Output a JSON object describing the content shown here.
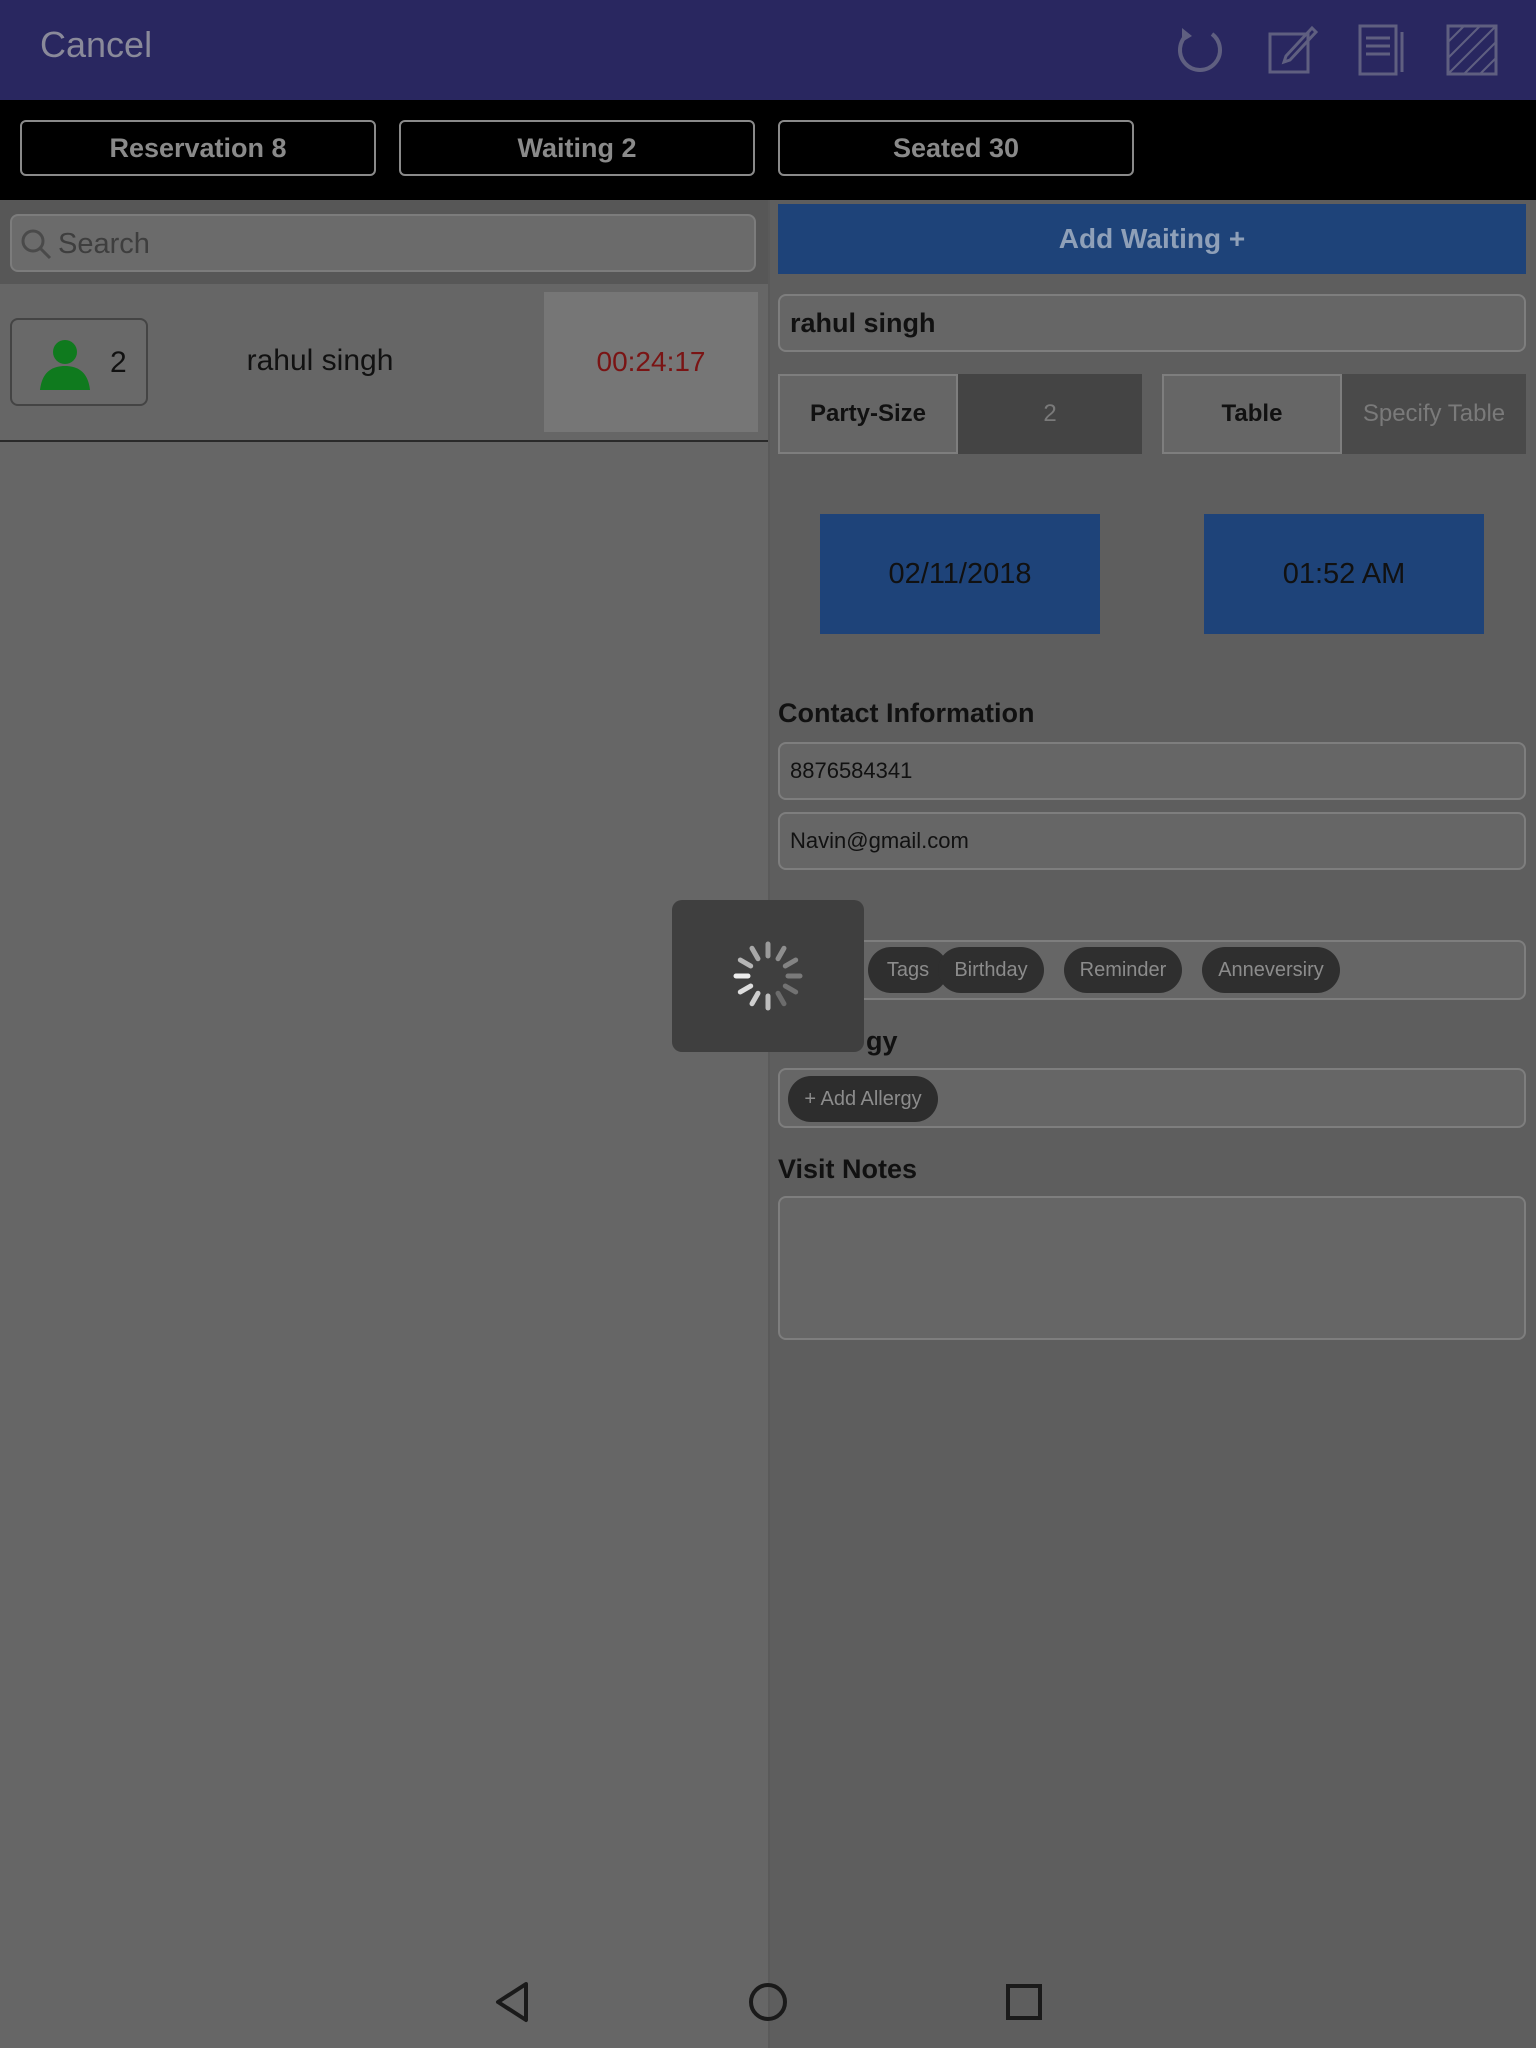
{
  "topbar": {
    "cancel_label": "Cancel",
    "icons": [
      "refresh-icon",
      "edit-icon",
      "notes-icon",
      "hatch-layout-icon"
    ]
  },
  "tabs": [
    {
      "label": "Reservation 8"
    },
    {
      "label": "Waiting 2"
    },
    {
      "label": "Seated 30"
    }
  ],
  "search": {
    "placeholder": "Search"
  },
  "list": [
    {
      "party_size": "2",
      "name": "rahul singh",
      "timer": "00:24:17"
    }
  ],
  "form": {
    "add_waiting_label": "Add Waiting +",
    "guest_name": "rahul singh",
    "party_size_label": "Party-Size",
    "party_size_value": "2",
    "table_label": "Table",
    "table_placeholder": "Specify Table",
    "date": "02/11/2018",
    "time": "01:52 AM",
    "contact_heading": "Contact Information",
    "phone": "8876584341",
    "email": "Navin@gmail.com",
    "tags_heading_visible": "",
    "tags": [
      "Tags",
      "Birthday",
      "Reminder",
      "Anneversiry"
    ],
    "allergy_heading_visible": "gy",
    "allergy_button": "+ Add Allergy",
    "visit_notes_heading": "Visit Notes",
    "visit_notes_value": ""
  },
  "loading": {
    "visible": true
  },
  "colors": {
    "topbar": "#292760",
    "accent_blue": "#1e4379",
    "timer_red": "#7a1414",
    "person_icon_green": "#0f7a1e"
  }
}
